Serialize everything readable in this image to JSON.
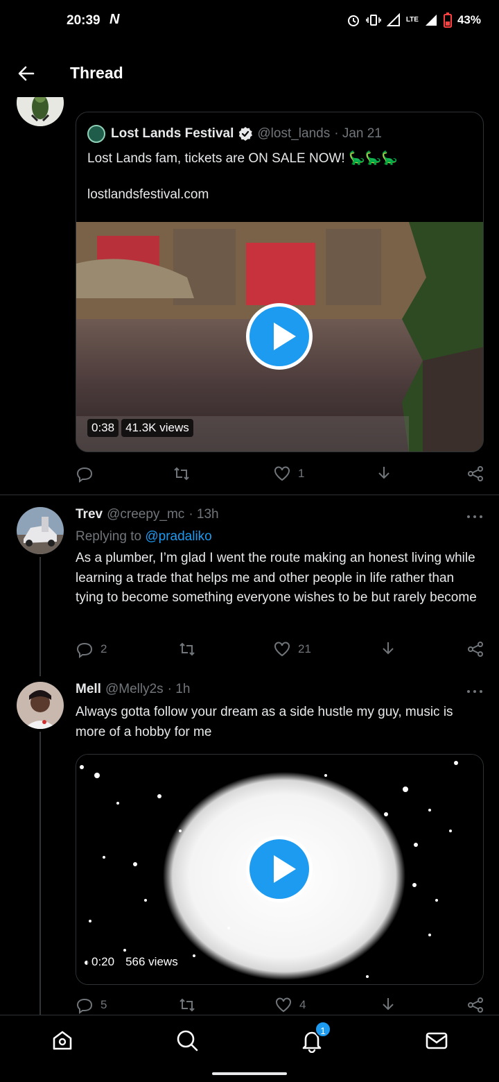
{
  "status_bar": {
    "time": "20:39",
    "carrier_icon": "N",
    "network": "LTE",
    "battery": "43%"
  },
  "header": {
    "title": "Thread",
    "back_icon": "arrow-left-icon"
  },
  "quoted_tweet": {
    "name": "Lost Lands Festival",
    "handle": "@lost_lands",
    "date": "· Jan 21",
    "text": "Lost Lands fam, tickets are ON SALE NOW! 🦕🦕🦕",
    "link": "lostlandsfestival.com",
    "video": {
      "duration": "0:38",
      "views": "41.3K views"
    },
    "likes": "1"
  },
  "replies": [
    {
      "name": "Trev",
      "handle": "@creepy_mc",
      "time": "· 13h",
      "replying_prefix": "Replying to ",
      "replying_to": "@pradaliko",
      "text": "As a plumber, I’m glad I went the route making an honest living while learning a trade that helps me and other people in life rather than tying to become something everyone wishes to be but rarely become",
      "replies": "2",
      "likes": "21"
    },
    {
      "name": "Mell",
      "handle": "@Melly2s",
      "time": "· 1h",
      "text": "Always gotta follow your dream as a side hustle my guy, music is more of a hobby for me",
      "video": {
        "duration": "0:20",
        "views": "566 views"
      },
      "replies": "5",
      "likes": "4"
    }
  ],
  "bottom_nav": {
    "notifications_badge": "1"
  },
  "colors": {
    "accent": "#1d9bf0",
    "muted": "#71767b",
    "background": "#000000"
  }
}
